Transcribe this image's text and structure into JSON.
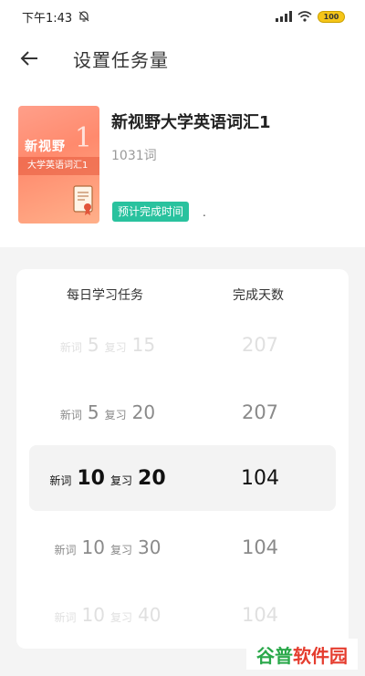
{
  "status_bar": {
    "time": "下午1:43",
    "battery": "100",
    "mute_icon": "bell-off-icon",
    "signal_icon": "signal-icon",
    "wifi_icon": "wifi-icon"
  },
  "header": {
    "title": "设置任务量",
    "back_icon": "arrow-left-icon"
  },
  "book": {
    "cover_series": "新视野",
    "cover_subtitle": "大学英语词汇1",
    "cover_number": "1",
    "title": "新视野大学英语词汇1",
    "word_count": "1031词",
    "finish_label": "预计完成时间",
    "finish_value": "."
  },
  "picker": {
    "col_task": "每日学习任务",
    "col_days": "完成天数",
    "rows": [
      {
        "new_label": "新词",
        "new": "5",
        "review_label": "复习",
        "review": "15",
        "days": "207"
      },
      {
        "new_label": "新词",
        "new": "5",
        "review_label": "复习",
        "review": "20",
        "days": "207"
      },
      {
        "new_label": "新词",
        "new": "10",
        "review_label": "复习",
        "review": "20",
        "days": "104"
      },
      {
        "new_label": "新词",
        "new": "10",
        "review_label": "复习",
        "review": "30",
        "days": "104"
      },
      {
        "new_label": "新词",
        "new": "10",
        "review_label": "复习",
        "review": "40",
        "days": "104"
      }
    ],
    "selected_index": 2
  },
  "watermark": {
    "part_a": "谷普",
    "part_b": "软件园"
  },
  "colors": {
    "accent": "#29c29e",
    "cover": "#ff8a6d",
    "background": "#f4f4f4"
  }
}
